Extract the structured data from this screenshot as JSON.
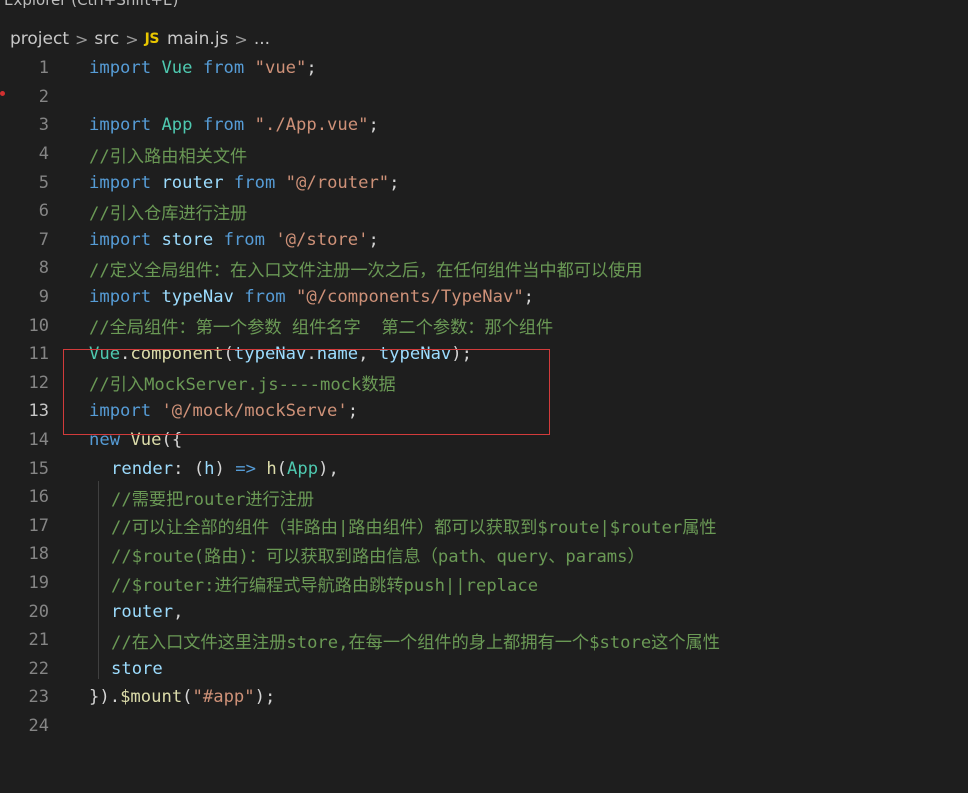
{
  "window": {
    "explorer_title": "Explorer (Ctrl+Shift+E)"
  },
  "breadcrumb": {
    "items": [
      "project",
      "src",
      "main.js",
      "..."
    ],
    "file_icon": "JS"
  },
  "editor": {
    "language": "javascript",
    "active_line": 13,
    "highlight_box_color": "#d23b3b",
    "lines": [
      {
        "n": "1",
        "text": "import Vue from \"vue\";"
      },
      {
        "n": "2",
        "text": ""
      },
      {
        "n": "3",
        "text": "import App from \"./App.vue\";"
      },
      {
        "n": "4",
        "text": "//引入路由相关文件"
      },
      {
        "n": "5",
        "text": "import router from \"@/router\";"
      },
      {
        "n": "6",
        "text": "//引入仓库进行注册"
      },
      {
        "n": "7",
        "text": "import store from '@/store';"
      },
      {
        "n": "8",
        "text": "//定义全局组件：在入口文件注册一次之后，在任何组件当中都可以使用"
      },
      {
        "n": "9",
        "text": "import typeNav from \"@/components/TypeNav\";"
      },
      {
        "n": "10",
        "text": "//全局组件：第一个参数 组件名字  第二个参数：那个组件"
      },
      {
        "n": "11",
        "text": "Vue.component(typeNav.name, typeNav);"
      },
      {
        "n": "12",
        "text": "//引入MockServer.js----mock数据"
      },
      {
        "n": "13",
        "text": "import '@/mock/mockServe';"
      },
      {
        "n": "14",
        "text": "new Vue({"
      },
      {
        "n": "15",
        "text": "  render: (h) => h(App),"
      },
      {
        "n": "16",
        "text": "  //需要把router进行注册"
      },
      {
        "n": "17",
        "text": "  //可以让全部的组件（非路由|路由组件）都可以获取到$route|$router属性"
      },
      {
        "n": "18",
        "text": "  //$route(路由)：可以获取到路由信息（path、query、params）"
      },
      {
        "n": "19",
        "text": "  //$router:进行编程式导航路由跳转push||replace"
      },
      {
        "n": "20",
        "text": "  router,"
      },
      {
        "n": "21",
        "text": "  //在入口文件这里注册store,在每一个组件的身上都拥有一个$store这个属性"
      },
      {
        "n": "22",
        "text": "  store"
      },
      {
        "n": "23",
        "text": "}).$mount(\"#app\");"
      },
      {
        "n": "24",
        "text": ""
      }
    ]
  }
}
